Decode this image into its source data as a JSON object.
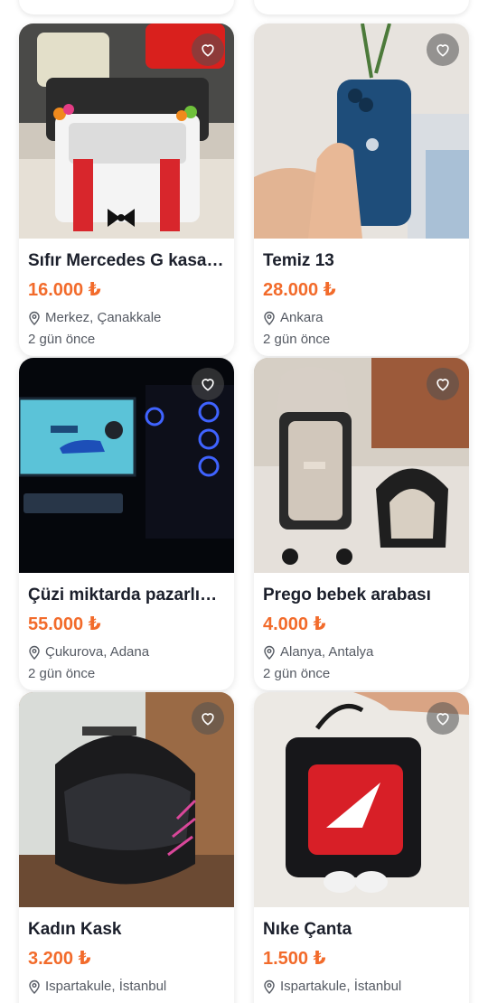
{
  "listings": [
    {
      "title": "Sıfır Mercedes G kasa ...",
      "price": "16.000 ₺",
      "location": "Merkez, Çanakkale",
      "posted": "2 gün önce"
    },
    {
      "title": "Temiz 13",
      "price": "28.000 ₺",
      "location": "Ankara",
      "posted": "2 gün önce"
    },
    {
      "title": "Çüzi miktarda pazarlık ...",
      "price": "55.000 ₺",
      "location": "Çukurova, Adana",
      "posted": "2 gün önce"
    },
    {
      "title": "Prego bebek arabası",
      "price": "4.000 ₺",
      "location": "Alanya, Antalya",
      "posted": "2 gün önce"
    },
    {
      "title": "Kadın Kask",
      "price": "3.200 ₺",
      "location": "Ispartakule, İstanbul",
      "posted": ""
    },
    {
      "title": "Nıke Çanta",
      "price": "1.500 ₺",
      "location": "Ispartakule, İstanbul",
      "posted": ""
    }
  ],
  "icons": {
    "favorite": "heart-outline-icon",
    "location": "map-pin-icon"
  },
  "colors": {
    "price": "#f26b2b",
    "title": "#1b1f2b",
    "meta": "#555a63"
  }
}
